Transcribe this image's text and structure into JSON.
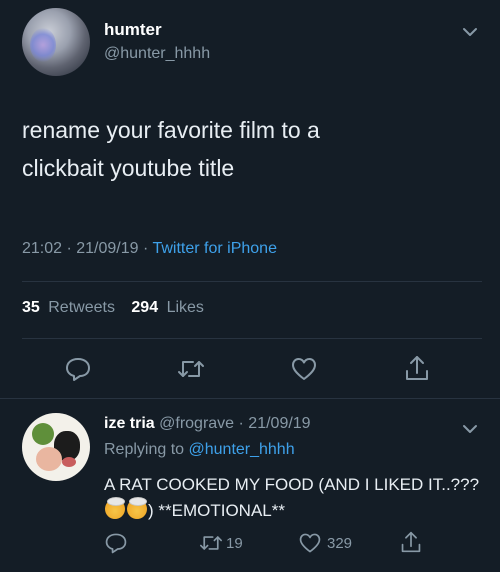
{
  "tweet": {
    "display_name": "humter",
    "handle": "@hunter_hhhh",
    "text_line1": "rename your favorite film to a",
    "text_line2": "clickbait youtube title",
    "time": "21:02 · 21/09/19 · ",
    "source": "Twitter for iPhone",
    "retweets_count": "35",
    "retweets_label": "Retweets",
    "likes_count": "294",
    "likes_label": "Likes",
    "icons": [
      "reply-icon",
      "retweet-icon",
      "like-icon",
      "share-icon",
      "chevron-down-icon"
    ]
  },
  "reply": {
    "display_name": "ize tria",
    "handle_time": "@frograve · 21/09/19",
    "replying_prefix": "Replying to ",
    "replying_to": "@hunter_hhhh",
    "text_part1": "A RAT COOKED MY FOOD (AND I LIKED IT..???",
    "text_part2": ") **EMOTIONAL**",
    "emoji_name": "exploding-head-emoji",
    "retweets": "19",
    "likes": "329"
  },
  "colors": {
    "background": "#141d26",
    "text": "#e8eef3",
    "muted": "#8899a6",
    "link": "#3ea1ea",
    "divider": "#283340"
  }
}
